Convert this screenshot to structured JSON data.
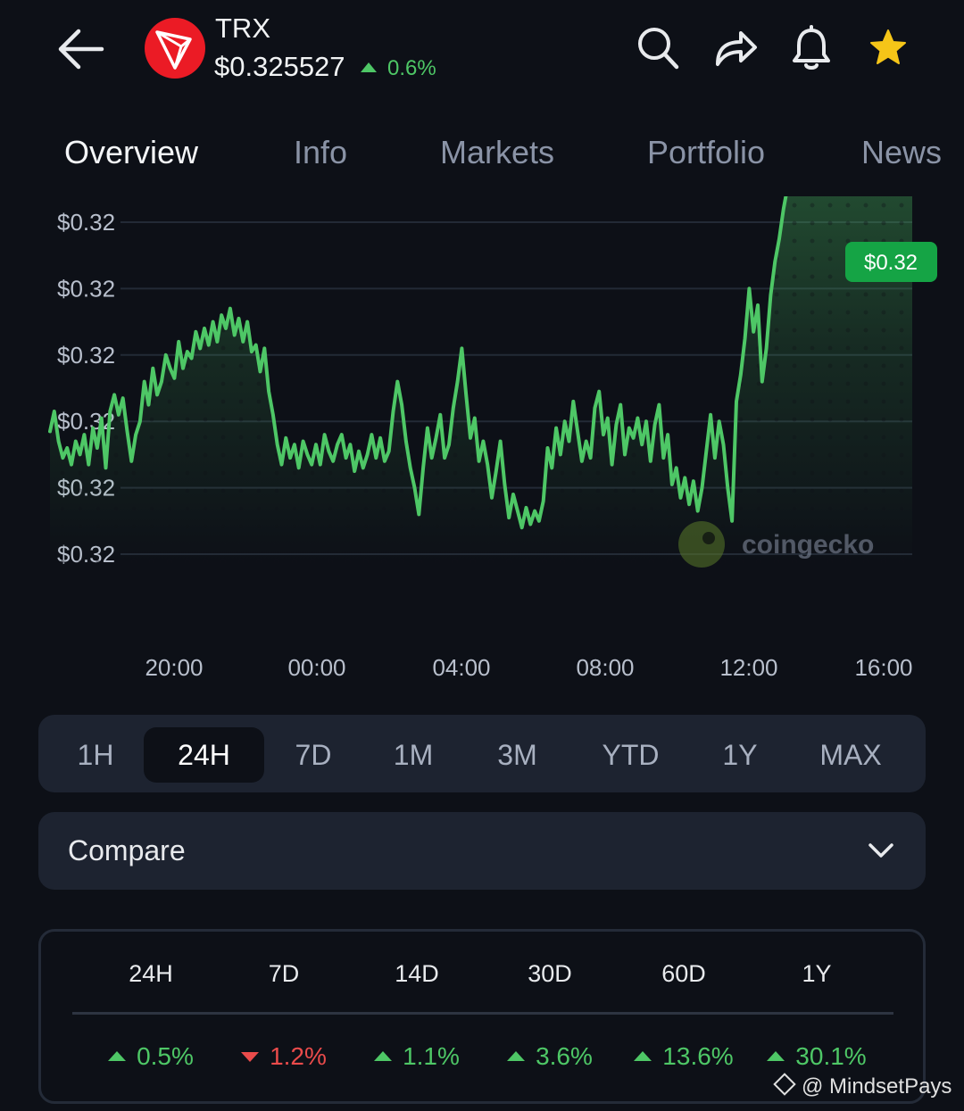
{
  "header": {
    "symbol": "TRX",
    "price": "$0.325527",
    "change": "0.6%"
  },
  "tabs": [
    "Overview",
    "Info",
    "Markets",
    "Portfolio",
    "News"
  ],
  "chart_data": {
    "type": "line",
    "y_tick_labels": [
      "$0.32",
      "$0.32",
      "$0.32",
      "$0.32",
      "$0.32",
      "$0.32"
    ],
    "x_tick_labels": [
      "20:00",
      "00:00",
      "04:00",
      "08:00",
      "12:00",
      "16:00"
    ],
    "current_label": "$0.32",
    "watermark": "coingecko",
    "grid": true,
    "line_color": "#4ec766",
    "y_range": [
      0,
      100
    ],
    "series": [
      {
        "values": [
          37,
          43,
          34,
          29,
          32,
          27,
          34,
          30,
          36,
          27,
          38,
          32,
          41,
          26,
          43,
          48,
          42,
          47,
          37,
          28,
          36,
          40,
          52,
          45,
          56,
          48,
          52,
          60,
          56,
          53,
          64,
          56,
          61,
          59,
          67,
          62,
          68,
          63,
          70,
          64,
          72,
          68,
          74,
          66,
          71,
          64,
          70,
          61,
          63,
          55,
          62,
          49,
          42,
          33,
          27,
          35,
          29,
          33,
          26,
          34,
          30,
          27,
          33,
          27,
          36,
          31,
          28,
          33,
          36,
          29,
          33,
          25,
          31,
          26,
          30,
          36,
          29,
          35,
          28,
          31,
          43,
          52,
          45,
          34,
          26,
          20,
          12,
          26,
          38,
          29,
          35,
          42,
          29,
          33,
          44,
          52,
          62,
          48,
          35,
          41,
          28,
          34,
          27,
          17,
          25,
          34,
          21,
          11,
          18,
          13,
          8,
          14,
          9,
          13,
          10,
          16,
          32,
          26,
          38,
          30,
          40,
          34,
          46,
          37,
          28,
          34,
          29,
          44,
          49,
          36,
          41,
          27,
          39,
          45,
          30,
          38,
          35,
          41,
          33,
          40,
          28,
          39,
          45,
          29,
          36,
          21,
          26,
          17,
          23,
          15,
          22,
          13,
          20,
          31,
          42,
          29,
          40,
          33,
          20,
          10,
          46,
          54,
          65,
          80,
          67,
          75,
          52,
          62,
          78,
          88,
          95,
          104,
          111,
          117,
          124,
          131,
          133,
          126,
          132,
          128,
          124,
          136,
          126,
          130,
          133,
          120,
          127,
          134,
          130,
          138,
          128,
          137,
          140,
          143,
          133,
          137,
          143,
          131,
          142,
          137,
          134,
          144
        ]
      }
    ]
  },
  "time_ranges": [
    "1H",
    "24H",
    "7D",
    "1M",
    "3M",
    "YTD",
    "1Y",
    "MAX"
  ],
  "active_range": "24H",
  "compare_label": "Compare",
  "performance": [
    {
      "period": "24H",
      "value": "0.5%",
      "dir": "up"
    },
    {
      "period": "7D",
      "value": "1.2%",
      "dir": "down"
    },
    {
      "period": "14D",
      "value": "1.1%",
      "dir": "up"
    },
    {
      "period": "30D",
      "value": "3.6%",
      "dir": "up"
    },
    {
      "period": "60D",
      "value": "13.6%",
      "dir": "up"
    },
    {
      "period": "1Y",
      "value": "30.1%",
      "dir": "up"
    }
  ],
  "watermark": "@ MindsetPays",
  "colors": {
    "accent_green": "#4ec766",
    "down_red": "#ea4b4b",
    "tron_red": "#eb1b25",
    "star_yellow": "#f5c518"
  },
  "icons": [
    "back-arrow-icon",
    "tron-logo-icon",
    "search-icon",
    "share-icon",
    "bell-icon",
    "star-icon",
    "chevron-down-icon"
  ]
}
